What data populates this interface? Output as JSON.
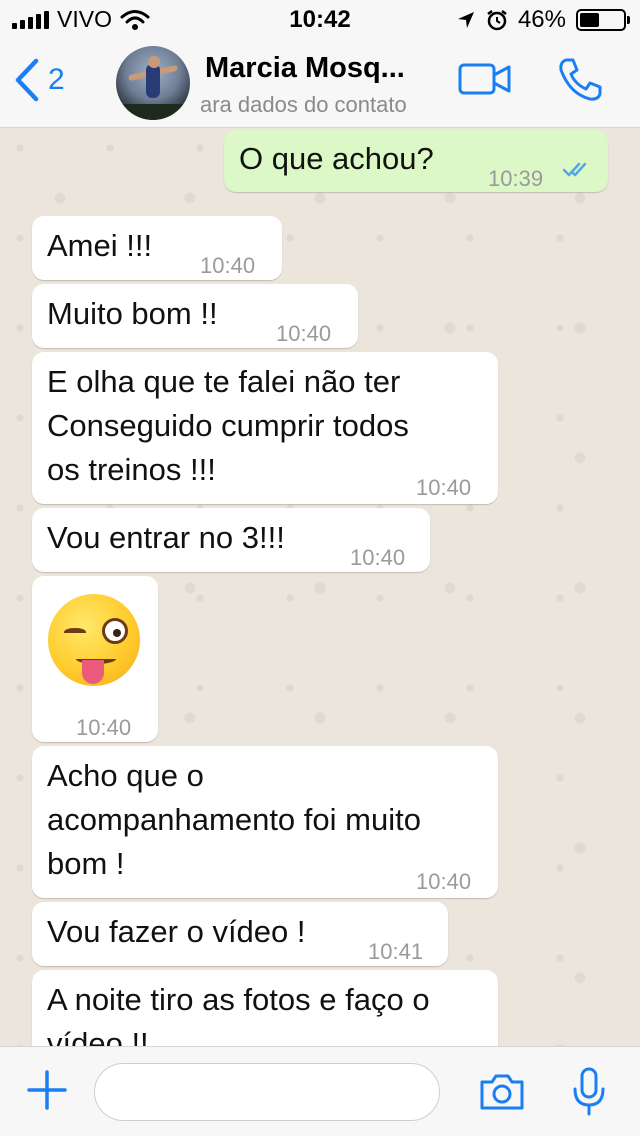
{
  "status_bar": {
    "carrier": "VIVO",
    "time": "10:42",
    "battery": "46%",
    "battery_level": 0.46
  },
  "header": {
    "back_count": "2",
    "contact_name": "Marcia Mosq...",
    "contact_subtitle": "ara dados do contato"
  },
  "messages": [
    {
      "direction": "out",
      "text": "O que achou?",
      "time": "10:39",
      "status": "read"
    },
    {
      "direction": "in",
      "text": "Amei !!!",
      "time": "10:40"
    },
    {
      "direction": "in",
      "text": "Muito bom !!",
      "time": "10:40"
    },
    {
      "direction": "in",
      "lines": [
        "E olha que te falei não ter",
        "Conseguido cumprir todos",
        "os treinos !!!"
      ],
      "time": "10:40"
    },
    {
      "direction": "in",
      "text": "Vou entrar no 3!!!",
      "time": "10:40"
    },
    {
      "direction": "in",
      "emoji": "winking-face-with-tongue",
      "time": "10:40"
    },
    {
      "direction": "in",
      "lines": [
        "Acho que o",
        "acompanhamento foi muito",
        "bom !"
      ],
      "time": "10:40"
    },
    {
      "direction": "in",
      "text": "Vou fazer o vídeo !",
      "time": "10:41"
    },
    {
      "direction": "in",
      "lines": [
        "A noite tiro as fotos e faço o",
        "vídeo !!"
      ]
    }
  ],
  "input_bar": {
    "placeholder": ""
  },
  "colors": {
    "accent": "#1a7ff2",
    "outgoing_bubble": "#dcf8c6",
    "incoming_bubble": "#ffffff",
    "chat_background": "#ece5dc",
    "read_ticks": "#4fa8e8"
  },
  "icons": [
    "signal-icon",
    "wifi-icon",
    "location-arrow-icon",
    "alarm-icon",
    "battery-icon",
    "back-chevron-icon",
    "video-call-icon",
    "phone-icon",
    "plus-icon",
    "camera-icon",
    "microphone-icon",
    "double-check-icon"
  ]
}
